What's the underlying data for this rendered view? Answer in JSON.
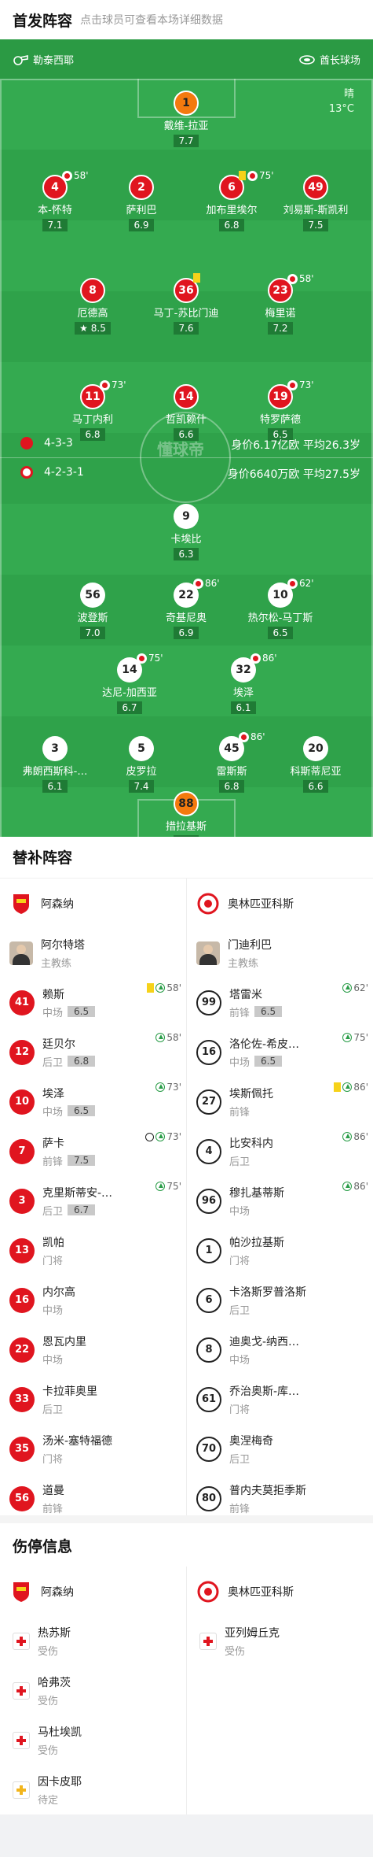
{
  "header": {
    "title": "首发阵容",
    "subtitle": "点击球员可查看本场详细数据"
  },
  "pitch": {
    "left_venue": "勒泰西耶",
    "right_venue": "酋长球场",
    "weather": "晴",
    "temperature": "13°C",
    "watermark": "懂球帝",
    "home": {
      "formation": "4-3-3",
      "value": "身价6.17亿欧",
      "age": "平均26.3岁"
    },
    "away": {
      "formation": "4-2-3-1",
      "value": "身价6640万欧",
      "age": "平均27.5岁"
    },
    "home_players": [
      {
        "num": "1",
        "name": "戴维-拉亚",
        "rating": "7.7",
        "color": "orange"
      },
      {
        "num": "4",
        "name": "本-怀特",
        "rating": "7.1",
        "sub": "58'",
        "color": "red"
      },
      {
        "num": "2",
        "name": "萨利巴",
        "rating": "6.9",
        "color": "red"
      },
      {
        "num": "6",
        "name": "加布里埃尔",
        "rating": "6.8",
        "sub": "75'",
        "card": "yellow",
        "color": "red"
      },
      {
        "num": "49",
        "name": "刘易斯-斯凯利",
        "rating": "7.5",
        "color": "red"
      },
      {
        "num": "8",
        "name": "厄德高",
        "rating": "8.5",
        "color": "red",
        "star": "true"
      },
      {
        "num": "36",
        "name": "马丁-苏比门迪",
        "rating": "7.6",
        "card": "yellow",
        "color": "red"
      },
      {
        "num": "23",
        "name": "梅里诺",
        "rating": "7.2",
        "sub": "58'",
        "color": "red"
      },
      {
        "num": "11",
        "name": "马丁内利",
        "rating": "6.8",
        "sub": "73'",
        "color": "red"
      },
      {
        "num": "14",
        "name": "哲凯赖什",
        "rating": "6.6",
        "color": "red"
      },
      {
        "num": "19",
        "name": "特罗萨德",
        "rating": "6.5",
        "sub": "73'",
        "color": "red"
      }
    ],
    "away_players": [
      {
        "num": "9",
        "name": "卡埃比",
        "rating": "6.3",
        "color": "white"
      },
      {
        "num": "56",
        "name": "波登斯",
        "rating": "7.0",
        "color": "white"
      },
      {
        "num": "22",
        "name": "奇基尼奥",
        "rating": "6.9",
        "sub": "86'",
        "color": "white"
      },
      {
        "num": "10",
        "name": "热尔松-马丁斯",
        "rating": "6.5",
        "sub": "62'",
        "color": "white"
      },
      {
        "num": "14",
        "name": "达尼-加西亚",
        "rating": "6.7",
        "sub": "75'",
        "color": "white"
      },
      {
        "num": "32",
        "name": "埃泽",
        "rating": "6.1",
        "sub": "86'",
        "color": "white"
      },
      {
        "num": "3",
        "name": "弗朗西斯科-…",
        "rating": "6.1",
        "color": "white"
      },
      {
        "num": "5",
        "name": "皮罗拉",
        "rating": "7.4",
        "color": "white"
      },
      {
        "num": "45",
        "name": "雷斯斯",
        "rating": "6.8",
        "sub": "86'",
        "color": "white"
      },
      {
        "num": "20",
        "name": "科斯蒂尼亚",
        "rating": "6.6",
        "color": "white"
      },
      {
        "num": "88",
        "name": "措拉基斯",
        "rating": "6.3",
        "color": "orange"
      }
    ]
  },
  "subs": {
    "title": "替补阵容",
    "home_team": "阿森纳",
    "away_team": "奥林匹亚科斯",
    "home_coach": {
      "name": "阿尔特塔",
      "role": "主教练"
    },
    "away_coach": {
      "name": "门迪利巴",
      "role": "主教练"
    },
    "home": [
      {
        "num": "41",
        "name": "赖斯",
        "pos": "中场",
        "rating": "6.5",
        "ev": "58'",
        "card": "yellow",
        "arrow": "true"
      },
      {
        "num": "12",
        "name": "廷贝尔",
        "pos": "后卫",
        "rating": "6.8",
        "ev": "58'",
        "arrow": "true"
      },
      {
        "num": "10",
        "name": "埃泽",
        "pos": "中场",
        "rating": "6.5",
        "ev": "73'",
        "arrow": "true"
      },
      {
        "num": "7",
        "name": "萨卡",
        "pos": "前锋",
        "rating": "7.5",
        "ev": "73'",
        "arrow": "true",
        "ball": "true"
      },
      {
        "num": "3",
        "name": "克里斯蒂安-…",
        "pos": "后卫",
        "rating": "6.7",
        "ev": "75'",
        "arrow": "true"
      },
      {
        "num": "13",
        "name": "凯帕",
        "pos": "门将"
      },
      {
        "num": "16",
        "name": "内尔高",
        "pos": "中场"
      },
      {
        "num": "22",
        "name": "恩瓦内里",
        "pos": "中场"
      },
      {
        "num": "33",
        "name": "卡拉菲奥里",
        "pos": "后卫"
      },
      {
        "num": "35",
        "name": "汤米-塞特福德",
        "pos": "门将"
      },
      {
        "num": "56",
        "name": "道曼",
        "pos": "前锋"
      }
    ],
    "away": [
      {
        "num": "99",
        "name": "塔雷米",
        "pos": "前锋",
        "rating": "6.5",
        "ev": "62'",
        "arrow": "true"
      },
      {
        "num": "16",
        "name": "洛伦佐-希皮…",
        "pos": "中场",
        "rating": "6.5",
        "ev": "75'",
        "arrow": "true"
      },
      {
        "num": "27",
        "name": "埃斯佩托",
        "pos": "前锋",
        "ev": "86'",
        "card": "yellow",
        "arrow": "true"
      },
      {
        "num": "4",
        "name": "比安科内",
        "pos": "后卫",
        "ev": "86'",
        "arrow": "true"
      },
      {
        "num": "96",
        "name": "穆扎基蒂斯",
        "pos": "中场",
        "ev": "86'",
        "arrow": "true"
      },
      {
        "num": "1",
        "name": "帕沙拉基斯",
        "pos": "门将"
      },
      {
        "num": "6",
        "name": "卡洛斯罗普洛斯",
        "pos": "后卫"
      },
      {
        "num": "8",
        "name": "迪奥戈-纳西…",
        "pos": "中场"
      },
      {
        "num": "61",
        "name": "乔治奥斯-库…",
        "pos": "门将"
      },
      {
        "num": "70",
        "name": "奥涅梅奇",
        "pos": "后卫"
      },
      {
        "num": "80",
        "name": "普内夫莫拒季斯",
        "pos": "前锋"
      }
    ]
  },
  "injuries": {
    "title": "伤停信息",
    "home_team": "阿森纳",
    "away_team": "奥林匹亚科斯",
    "home": [
      {
        "name": "热苏斯",
        "status": "受伤",
        "icon": "red-cross-icon"
      },
      {
        "name": "哈弗茨",
        "status": "受伤",
        "icon": "red-cross-icon"
      },
      {
        "name": "马杜埃凯",
        "status": "受伤",
        "icon": "red-cross-icon"
      },
      {
        "name": "因卡皮耶",
        "status": "待定",
        "icon": "yellow-cross-icon"
      }
    ],
    "away": [
      {
        "name": "亚列姆丘克",
        "status": "受伤",
        "icon": "red-cross-icon"
      }
    ]
  }
}
